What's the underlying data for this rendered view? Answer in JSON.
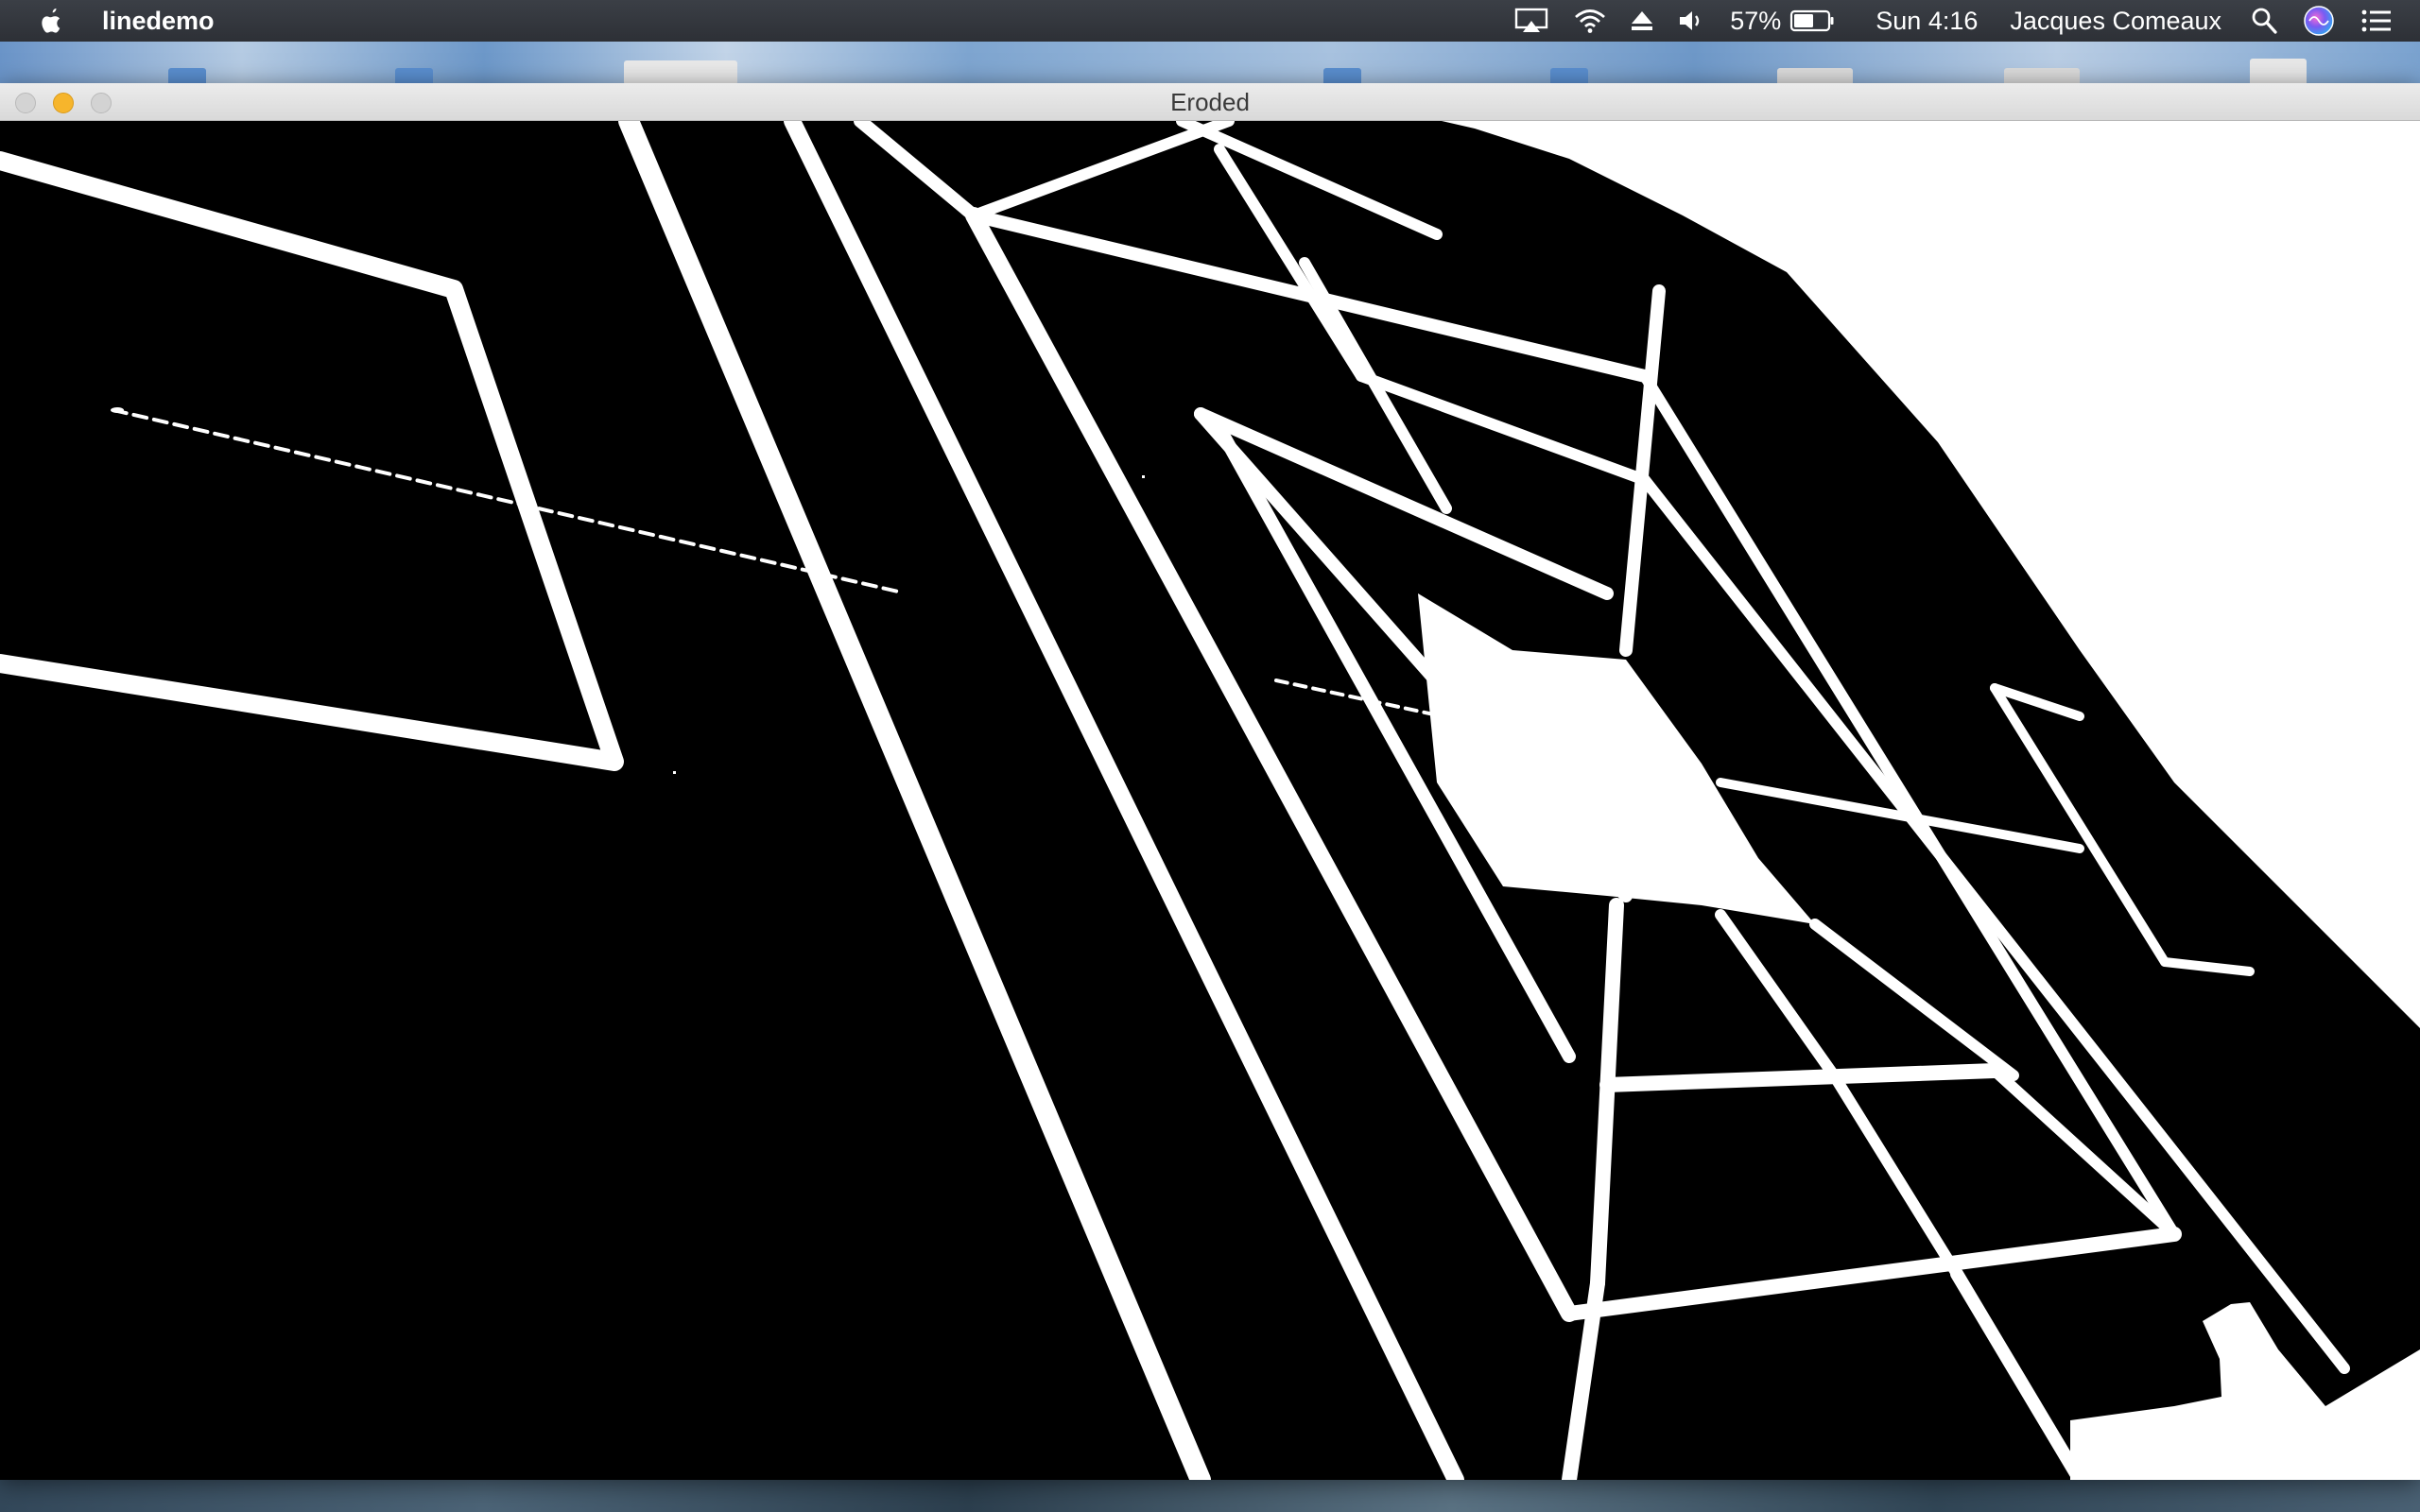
{
  "menubar": {
    "app_name": "linedemo",
    "battery_percent": "57%",
    "clock": "Sun 4:16",
    "user_name": "Jacques Comeaux",
    "icons": [
      "apple-icon",
      "airplay-icon",
      "wifi-icon",
      "eject-icon",
      "volume-icon",
      "battery-icon",
      "spotlight-icon",
      "siri-icon",
      "notification-center-icon"
    ]
  },
  "window": {
    "title": "Eroded",
    "content": "binary eroded image"
  },
  "colors": {
    "menubar_bg": "#2d3036",
    "titlebar_bg": "#e3e3e3",
    "minimize_button": "#f6b52c",
    "image_foreground": "#ffffff",
    "image_background": "#000000"
  }
}
